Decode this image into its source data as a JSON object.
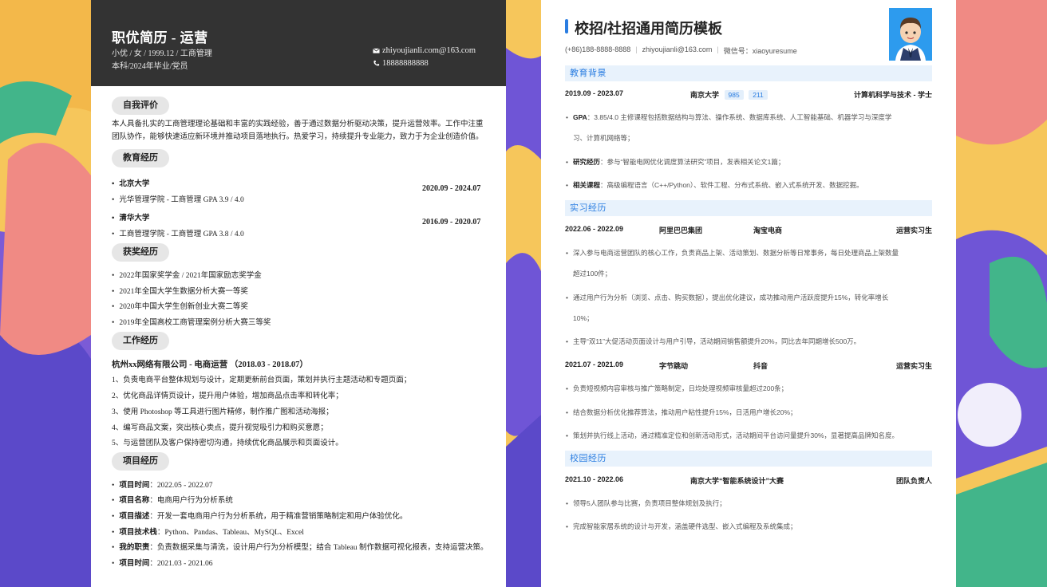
{
  "left": {
    "name": "职优简历 - 运营",
    "info_line1": "小优 / 女 / 1999.12 / 工商管理",
    "info_line2": "本科/2024年毕业/党员",
    "email": "zhiyoujianli.com@163.com",
    "phone": "18888888888",
    "sections": {
      "self": "自我评价",
      "edu": "教育经历",
      "award": "获奖经历",
      "work": "工作经历",
      "project": "项目经历"
    },
    "self_text": "本人具备扎实的工商管理理论基础和丰富的实践经验，善于通过数据分析驱动决策，提升运营效率。工作中注重团队协作，能够快速适应新环境并推动项目落地执行。热爱学习，持续提升专业能力，致力于为企业创造价值。",
    "education": [
      {
        "school": "北京大学",
        "detail": "光华管理学院 - 工商管理 GPA 3.9 / 4.0",
        "date": "2020.09 - 2024.07"
      },
      {
        "school": "清华大学",
        "detail": "工商管理学院 - 工商管理 GPA 3.8 / 4.0",
        "date": "2016.09 - 2020.07"
      }
    ],
    "awards": [
      "2022年国家奖学金 / 2021年国家励志奖学金",
      "2021年全国大学生数据分析大赛一等奖",
      "2020年中国大学生创新创业大赛二等奖",
      "2019年全国高校工商管理案例分析大赛三等奖"
    ],
    "work_title": "杭州xx网络有限公司 - 电商运营 （2018.03 - 2018.07）",
    "work_items": [
      "1、负责电商平台整体规划与设计，定期更新前台页面，策划并执行主题活动和专题页面；",
      "2、优化商品详情页设计，提升用户体验，增加商品点击率和转化率；",
      "3、使用 Photoshop 等工具进行图片精修，制作推广图和活动海报；",
      "4、编写商品文案，突出核心卖点，提升视觉吸引力和购买意愿；",
      "5、与运营团队及客户保持密切沟通，持续优化商品展示和页面设计。"
    ],
    "project_items": [
      {
        "label": "项目时间",
        "value": "：2022.05 - 2022.07"
      },
      {
        "label": "项目名称",
        "value": "：电商用户行为分析系统"
      },
      {
        "label": "项目描述",
        "value": "：开发一套电商用户行为分析系统，用于精准营销策略制定和用户体验优化。"
      },
      {
        "label": "项目技术栈",
        "value": "：Python、Pandas、Tableau、MySQL、Excel"
      },
      {
        "label": "我的职责",
        "value": "：负责数据采集与清洗，设计用户行为分析模型；结合 Tableau 制作数据可视化报表，支持运营决策。"
      },
      {
        "label": "项目时间",
        "value": "：2021.03 - 2021.06"
      }
    ]
  },
  "right": {
    "title": "校招/社招通用简历模板",
    "contact": [
      "(+86)188-8888-8888",
      "zhiyoujianli@163.com",
      "微信号：xiaoyuresume"
    ],
    "sections": {
      "edu": "教育背景",
      "intern": "实习经历",
      "campus": "校园经历"
    },
    "edu_row": {
      "date": "2019.09 - 2023.07",
      "school": "南京大学",
      "tags": [
        "985",
        "211"
      ],
      "major": "计算机科学与技术 - 学士"
    },
    "edu_bullets": [
      {
        "label": "GPA",
        "text": "：3.85/4.0 主修课程包括数据结构与算法、操作系统、数据库系统、人工智能基础、机器学习与深度学",
        "cont": "习、计算机网络等；"
      },
      {
        "label": "研究经历",
        "text": "：参与“智能电网优化调度算法研究”项目，发表相关论文1篇；"
      },
      {
        "label": "相关课程",
        "text": "：高级编程语言（C++/Python）、软件工程、分布式系统、嵌入式系统开发、数据挖掘。"
      }
    ],
    "intern1": {
      "date": "2022.06 - 2022.09",
      "company": "阿里巴巴集团",
      "dept": "淘宝电商",
      "role": "运营实习生"
    },
    "intern1_bullets": [
      {
        "text": "深入参与电商运营团队的核心工作，负责商品上架、活动策划、数据分析等日常事务，每日处理商品上架数量",
        "cont": "超过100件；"
      },
      {
        "text": "通过用户行为分析（浏览、点击、购买数据），提出优化建议，成功推动用户活跃度提升15%，转化率增长",
        "cont": "10%；"
      },
      {
        "text": "主导“双11”大促活动页面设计与用户引导，活动期间销售额提升20%，同比去年同期增长500万。"
      }
    ],
    "intern2": {
      "date": "2021.07 - 2021.09",
      "company": "字节跳动",
      "dept": "抖音",
      "role": "运营实习生"
    },
    "intern2_bullets": [
      "负责短视频内容审核与推广策略制定，日均处理视频审核量超过200条；",
      "结合数据分析优化推荐算法，推动用户粘性提升15%，日活用户增长20%；",
      "策划并执行线上活动，通过精准定位和创新活动形式，活动期间平台访问量提升30%，显著提高品牌知名度。"
    ],
    "campus_row": {
      "date": "2021.10 - 2022.06",
      "org": "南京大学“智能系统设计”大赛",
      "role": "团队负责人"
    },
    "campus_bullets": [
      "领导5人团队参与比赛，负责项目整体规划及执行；",
      "完成智能家居系统的设计与开发，涵盖硬件选型、嵌入式编程及系统集成；"
    ]
  }
}
